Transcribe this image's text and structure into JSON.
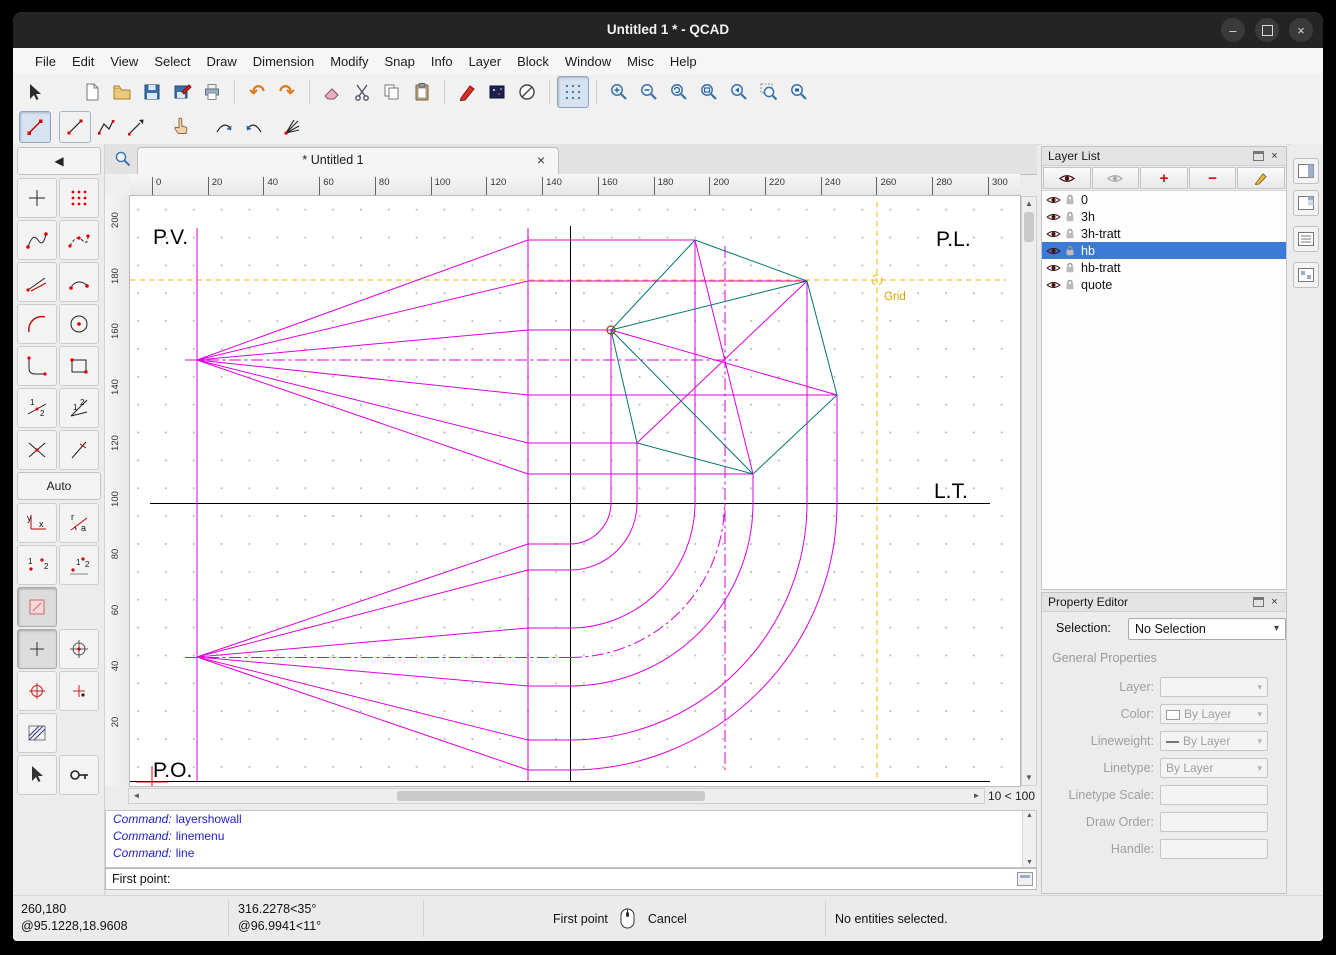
{
  "window": {
    "title": "Untitled 1 * - QCAD"
  },
  "icons": {
    "close": "×",
    "minimize": "–",
    "back": "◀",
    "left": "◄",
    "right": "►",
    "up": "▲",
    "down": "▼",
    "dropdown": "▾",
    "plus": "+",
    "minus": "−",
    "undo": "↶",
    "redo": "↷"
  },
  "menubar": [
    "File",
    "Edit",
    "View",
    "Select",
    "Draw",
    "Dimension",
    "Modify",
    "Snap",
    "Info",
    "Layer",
    "Block",
    "Window",
    "Misc",
    "Help"
  ],
  "tab": {
    "label": "* Untitled 1"
  },
  "rulers": {
    "h": [
      "0",
      "20",
      "40",
      "60",
      "80",
      "100",
      "120",
      "140",
      "160",
      "180",
      "200",
      "220",
      "240",
      "260",
      "280",
      "300"
    ],
    "v": [
      "200",
      "180",
      "160",
      "140",
      "120",
      "100",
      "80",
      "60",
      "40",
      "20"
    ]
  },
  "drawing": {
    "labels": {
      "pv": "P.V.",
      "pl": "P.L.",
      "lt": "L.T.",
      "po": "P.O.",
      "grid": "Grid"
    }
  },
  "scrollbar": {
    "hint": "10 < 100"
  },
  "command": {
    "lines": [
      {
        "prefix": "Command:",
        "text": "layershowall"
      },
      {
        "prefix": "Command:",
        "text": "linemenu"
      },
      {
        "prefix": "Command:",
        "text": "line"
      }
    ],
    "prompt": "First point:"
  },
  "layer_list": {
    "title": "Layer List",
    "layers": [
      {
        "name": "0"
      },
      {
        "name": "3h"
      },
      {
        "name": "3h-tratt"
      },
      {
        "name": "hb",
        "selected": true
      },
      {
        "name": "hb-tratt"
      },
      {
        "name": "quote"
      }
    ]
  },
  "property_editor": {
    "title": "Property Editor",
    "selection_label": "Selection:",
    "selection_value": "No Selection",
    "general": "General Properties",
    "layer_label": "Layer:",
    "color_label": "Color:",
    "color_value": "By Layer",
    "lineweight_label": "Lineweight:",
    "lineweight_value": "By Layer",
    "linetype_label": "Linetype:",
    "linetype_value": "By Layer",
    "linetype_scale_label": "Linetype Scale:",
    "draw_order_label": "Draw Order:",
    "handle_label": "Handle:"
  },
  "palette": {
    "auto": "Auto",
    "x": "x",
    "y": "y",
    "r": "r",
    "a": "a",
    "one": "1",
    "two": "2"
  },
  "statusbar": {
    "abs_coord": "260,180",
    "rel_coord": "@95.1228,18.9608",
    "abs_polar": "316.2278<35°",
    "rel_polar": "@96.9941<11°",
    "left_button": "First point",
    "right_button": "Cancel",
    "selection_info": "No entities selected."
  }
}
